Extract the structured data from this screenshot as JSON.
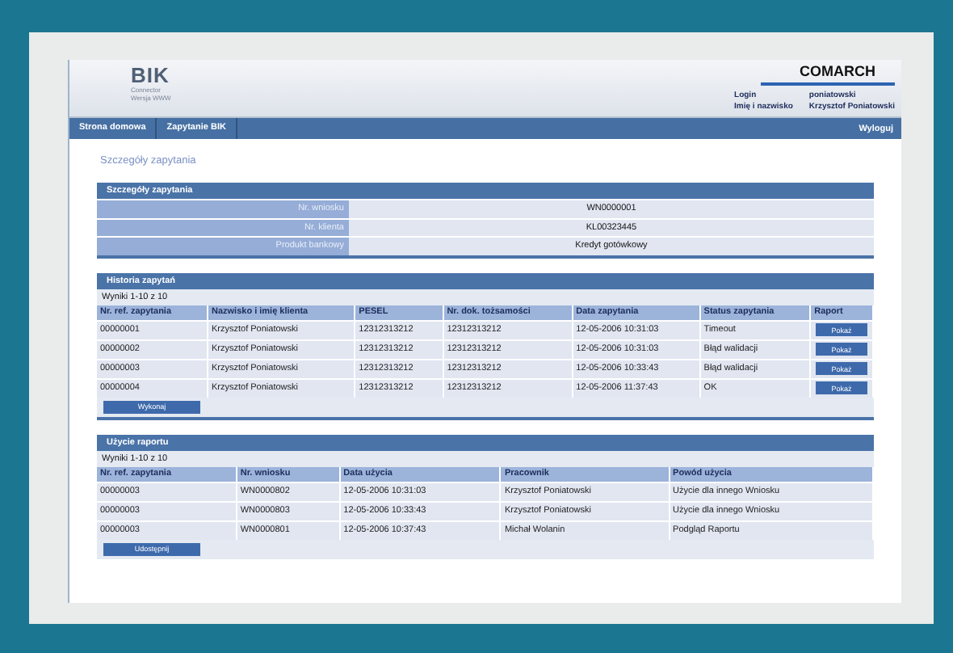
{
  "header": {
    "logo": "BIK",
    "logo_lines": [
      "Connector",
      "Wersja WWW"
    ],
    "brand": "COMARCH",
    "user": [
      {
        "label": "Login",
        "value": "poniatowski"
      },
      {
        "label": "Imię i nazwisko",
        "value": "Krzysztof Poniatowski"
      }
    ]
  },
  "nav": {
    "items": [
      "Strona domowa",
      "Zapytanie BIK"
    ],
    "logout": "Wyloguj"
  },
  "page_title": "Szczegóły zapytania",
  "details": {
    "title": "Szczegóły zapytania",
    "fields": [
      {
        "label": "Nr. wniosku",
        "value": "WN0000001"
      },
      {
        "label": "Nr. klienta",
        "value": "KL00323445"
      },
      {
        "label": "Produkt bankowy",
        "value": "Kredyt gotówkowy"
      }
    ]
  },
  "history": {
    "title": "Historia zapytań",
    "results": "Wyniki 1-10 z 10",
    "columns": [
      "Nr. ref. zapytania",
      "Nazwisko i imię klienta",
      "PESEL",
      "Nr. dok. tożsamości",
      "Data zapytania",
      "Status zapytania",
      "Raport"
    ],
    "rows": [
      {
        "cells": [
          "00000001",
          "Krzysztof Poniatowski",
          "12312313212",
          "12312313212",
          "12-05-2006 10:31:03",
          "Timeout"
        ],
        "button": "Pokaż"
      },
      {
        "cells": [
          "00000002",
          "Krzysztof Poniatowski",
          "12312313212",
          "12312313212",
          "12-05-2006 10:31:03",
          "Błąd walidacji"
        ],
        "button": "Pokaż"
      },
      {
        "cells": [
          "00000003",
          "Krzysztof Poniatowski",
          "12312313212",
          "12312313212",
          "12-05-2006 10:33:43",
          "Błąd walidacji"
        ],
        "button": "Pokaż"
      },
      {
        "cells": [
          "00000004",
          "Krzysztof Poniatowski",
          "12312313212",
          "12312313212",
          "12-05-2006 11:37:43",
          "OK"
        ],
        "button": "Pokaż"
      }
    ],
    "action": "Wykonaj"
  },
  "usage": {
    "title": "Użycie raportu",
    "results": "Wyniki 1-10 z 10",
    "columns": [
      "Nr. ref. zapytania",
      "Nr. wniosku",
      "Data użycia",
      "Pracownik",
      "Powód użycia"
    ],
    "rows": [
      {
        "cells": [
          "00000003",
          "WN0000802",
          "12-05-2006 10:31:03",
          "Krzysztof Poniatowski",
          "Użycie dla innego Wniosku"
        ]
      },
      {
        "cells": [
          "00000003",
          "WN0000803",
          "12-05-2006 10:33:43",
          "Krzysztof Poniatowski",
          "Użycie dla innego Wniosku"
        ]
      },
      {
        "cells": [
          "00000003",
          "WN0000801",
          "12-05-2006 10:37:43",
          "Michał Wolanin",
          "Podgląd Raportu"
        ]
      }
    ],
    "action": "Udostępnij"
  }
}
